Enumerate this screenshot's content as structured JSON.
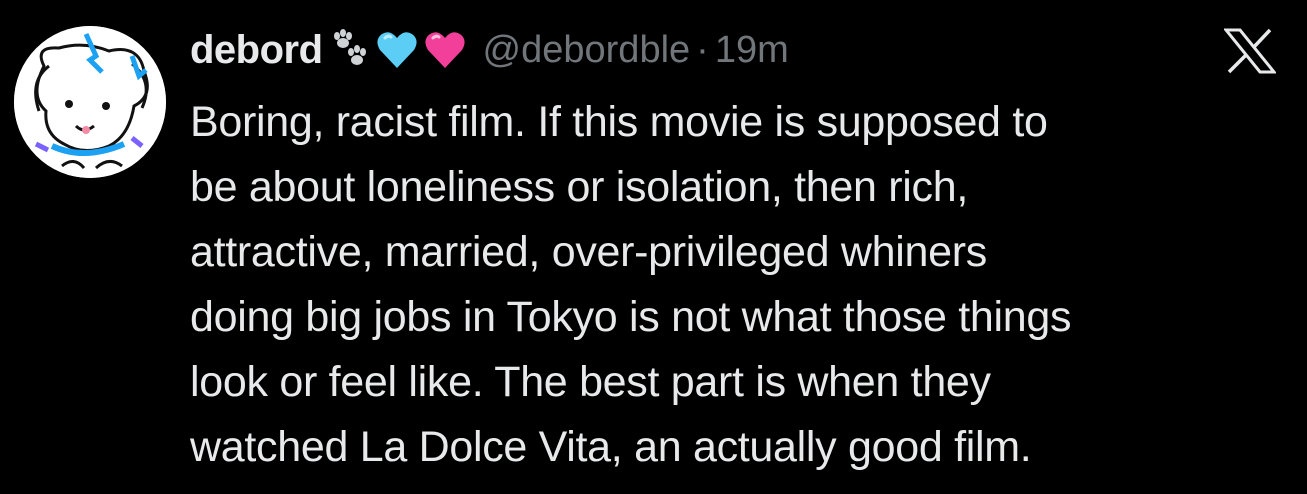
{
  "tweet": {
    "display_name": "debord",
    "name_emojis": [
      "paw-prints-emoji",
      "light-blue-heart-emoji",
      "pink-heart-emoji"
    ],
    "handle": "@debordble",
    "separator": "·",
    "time": "19m",
    "platform_logo": "x-logo-icon",
    "text_lines": [
      "Boring, racist film. If this movie is supposed to",
      "be about loneliness or isolation, then rich,",
      "attractive, married, over-privileged whiners",
      "doing big jobs in Tokyo is not what those things",
      "look or feel like. The best part is when they",
      "watched La Dolce Vita, an actually good film."
    ]
  },
  "colors": {
    "background": "#000000",
    "primary_text": "#e7e9ea",
    "secondary_text": "#71767b",
    "light_blue_heart": "#5ccdf5",
    "pink_heart": "#f2409a"
  }
}
